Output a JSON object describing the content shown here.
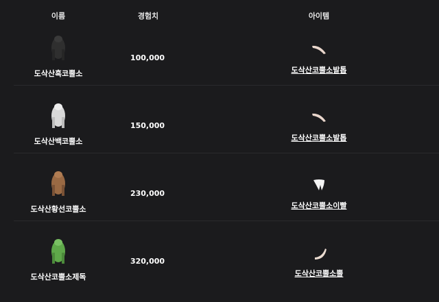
{
  "header": {
    "name": "이름",
    "exp": "경험치",
    "item": "아이템"
  },
  "rows": [
    {
      "monster": "도삭산흑코뿔소",
      "exp": "100,000",
      "item": "도삭산코뿔소발톱",
      "monster_color": "#2f2f2f",
      "item_icon": "claw-icon"
    },
    {
      "monster": "도삭산백코뿔소",
      "exp": "150,000",
      "item": "도삭산코뿔소발톱",
      "monster_color": "#d8d8d8",
      "item_icon": "claw-icon"
    },
    {
      "monster": "도삭산황선코뿔소",
      "exp": "230,000",
      "item": "도삭산코뿔소이빨",
      "monster_color": "#9a6a44",
      "item_icon": "tooth-icon"
    },
    {
      "monster": "도삭산코뿔소제독",
      "exp": "320,000",
      "item": "도삭산코뿔소뿔",
      "monster_color": "#5fa84a",
      "item_icon": "horn-icon"
    }
  ]
}
